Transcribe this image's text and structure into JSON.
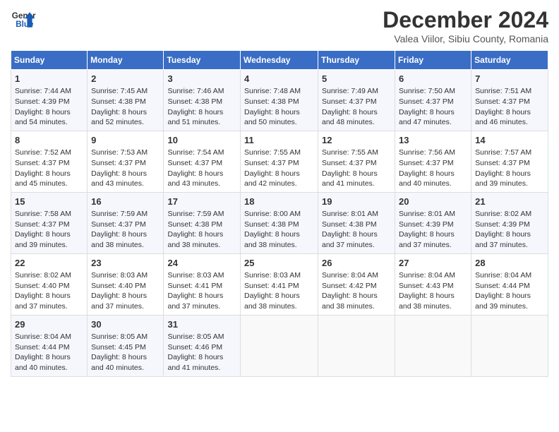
{
  "header": {
    "logo_line1": "General",
    "logo_line2": "Blue",
    "title": "December 2024",
    "subtitle": "Valea Viilor, Sibiu County, Romania"
  },
  "days_of_week": [
    "Sunday",
    "Monday",
    "Tuesday",
    "Wednesday",
    "Thursday",
    "Friday",
    "Saturday"
  ],
  "weeks": [
    [
      {
        "day": "1",
        "lines": [
          "Sunrise: 7:44 AM",
          "Sunset: 4:39 PM",
          "Daylight: 8 hours",
          "and 54 minutes."
        ]
      },
      {
        "day": "2",
        "lines": [
          "Sunrise: 7:45 AM",
          "Sunset: 4:38 PM",
          "Daylight: 8 hours",
          "and 52 minutes."
        ]
      },
      {
        "day": "3",
        "lines": [
          "Sunrise: 7:46 AM",
          "Sunset: 4:38 PM",
          "Daylight: 8 hours",
          "and 51 minutes."
        ]
      },
      {
        "day": "4",
        "lines": [
          "Sunrise: 7:48 AM",
          "Sunset: 4:38 PM",
          "Daylight: 8 hours",
          "and 50 minutes."
        ]
      },
      {
        "day": "5",
        "lines": [
          "Sunrise: 7:49 AM",
          "Sunset: 4:37 PM",
          "Daylight: 8 hours",
          "and 48 minutes."
        ]
      },
      {
        "day": "6",
        "lines": [
          "Sunrise: 7:50 AM",
          "Sunset: 4:37 PM",
          "Daylight: 8 hours",
          "and 47 minutes."
        ]
      },
      {
        "day": "7",
        "lines": [
          "Sunrise: 7:51 AM",
          "Sunset: 4:37 PM",
          "Daylight: 8 hours",
          "and 46 minutes."
        ]
      }
    ],
    [
      {
        "day": "8",
        "lines": [
          "Sunrise: 7:52 AM",
          "Sunset: 4:37 PM",
          "Daylight: 8 hours",
          "and 45 minutes."
        ]
      },
      {
        "day": "9",
        "lines": [
          "Sunrise: 7:53 AM",
          "Sunset: 4:37 PM",
          "Daylight: 8 hours",
          "and 43 minutes."
        ]
      },
      {
        "day": "10",
        "lines": [
          "Sunrise: 7:54 AM",
          "Sunset: 4:37 PM",
          "Daylight: 8 hours",
          "and 43 minutes."
        ]
      },
      {
        "day": "11",
        "lines": [
          "Sunrise: 7:55 AM",
          "Sunset: 4:37 PM",
          "Daylight: 8 hours",
          "and 42 minutes."
        ]
      },
      {
        "day": "12",
        "lines": [
          "Sunrise: 7:55 AM",
          "Sunset: 4:37 PM",
          "Daylight: 8 hours",
          "and 41 minutes."
        ]
      },
      {
        "day": "13",
        "lines": [
          "Sunrise: 7:56 AM",
          "Sunset: 4:37 PM",
          "Daylight: 8 hours",
          "and 40 minutes."
        ]
      },
      {
        "day": "14",
        "lines": [
          "Sunrise: 7:57 AM",
          "Sunset: 4:37 PM",
          "Daylight: 8 hours",
          "and 39 minutes."
        ]
      }
    ],
    [
      {
        "day": "15",
        "lines": [
          "Sunrise: 7:58 AM",
          "Sunset: 4:37 PM",
          "Daylight: 8 hours",
          "and 39 minutes."
        ]
      },
      {
        "day": "16",
        "lines": [
          "Sunrise: 7:59 AM",
          "Sunset: 4:37 PM",
          "Daylight: 8 hours",
          "and 38 minutes."
        ]
      },
      {
        "day": "17",
        "lines": [
          "Sunrise: 7:59 AM",
          "Sunset: 4:38 PM",
          "Daylight: 8 hours",
          "and 38 minutes."
        ]
      },
      {
        "day": "18",
        "lines": [
          "Sunrise: 8:00 AM",
          "Sunset: 4:38 PM",
          "Daylight: 8 hours",
          "and 38 minutes."
        ]
      },
      {
        "day": "19",
        "lines": [
          "Sunrise: 8:01 AM",
          "Sunset: 4:38 PM",
          "Daylight: 8 hours",
          "and 37 minutes."
        ]
      },
      {
        "day": "20",
        "lines": [
          "Sunrise: 8:01 AM",
          "Sunset: 4:39 PM",
          "Daylight: 8 hours",
          "and 37 minutes."
        ]
      },
      {
        "day": "21",
        "lines": [
          "Sunrise: 8:02 AM",
          "Sunset: 4:39 PM",
          "Daylight: 8 hours",
          "and 37 minutes."
        ]
      }
    ],
    [
      {
        "day": "22",
        "lines": [
          "Sunrise: 8:02 AM",
          "Sunset: 4:40 PM",
          "Daylight: 8 hours",
          "and 37 minutes."
        ]
      },
      {
        "day": "23",
        "lines": [
          "Sunrise: 8:03 AM",
          "Sunset: 4:40 PM",
          "Daylight: 8 hours",
          "and 37 minutes."
        ]
      },
      {
        "day": "24",
        "lines": [
          "Sunrise: 8:03 AM",
          "Sunset: 4:41 PM",
          "Daylight: 8 hours",
          "and 37 minutes."
        ]
      },
      {
        "day": "25",
        "lines": [
          "Sunrise: 8:03 AM",
          "Sunset: 4:41 PM",
          "Daylight: 8 hours",
          "and 38 minutes."
        ]
      },
      {
        "day": "26",
        "lines": [
          "Sunrise: 8:04 AM",
          "Sunset: 4:42 PM",
          "Daylight: 8 hours",
          "and 38 minutes."
        ]
      },
      {
        "day": "27",
        "lines": [
          "Sunrise: 8:04 AM",
          "Sunset: 4:43 PM",
          "Daylight: 8 hours",
          "and 38 minutes."
        ]
      },
      {
        "day": "28",
        "lines": [
          "Sunrise: 8:04 AM",
          "Sunset: 4:44 PM",
          "Daylight: 8 hours",
          "and 39 minutes."
        ]
      }
    ],
    [
      {
        "day": "29",
        "lines": [
          "Sunrise: 8:04 AM",
          "Sunset: 4:44 PM",
          "Daylight: 8 hours",
          "and 40 minutes."
        ]
      },
      {
        "day": "30",
        "lines": [
          "Sunrise: 8:05 AM",
          "Sunset: 4:45 PM",
          "Daylight: 8 hours",
          "and 40 minutes."
        ]
      },
      {
        "day": "31",
        "lines": [
          "Sunrise: 8:05 AM",
          "Sunset: 4:46 PM",
          "Daylight: 8 hours",
          "and 41 minutes."
        ]
      },
      {
        "day": "",
        "lines": []
      },
      {
        "day": "",
        "lines": []
      },
      {
        "day": "",
        "lines": []
      },
      {
        "day": "",
        "lines": []
      }
    ]
  ]
}
